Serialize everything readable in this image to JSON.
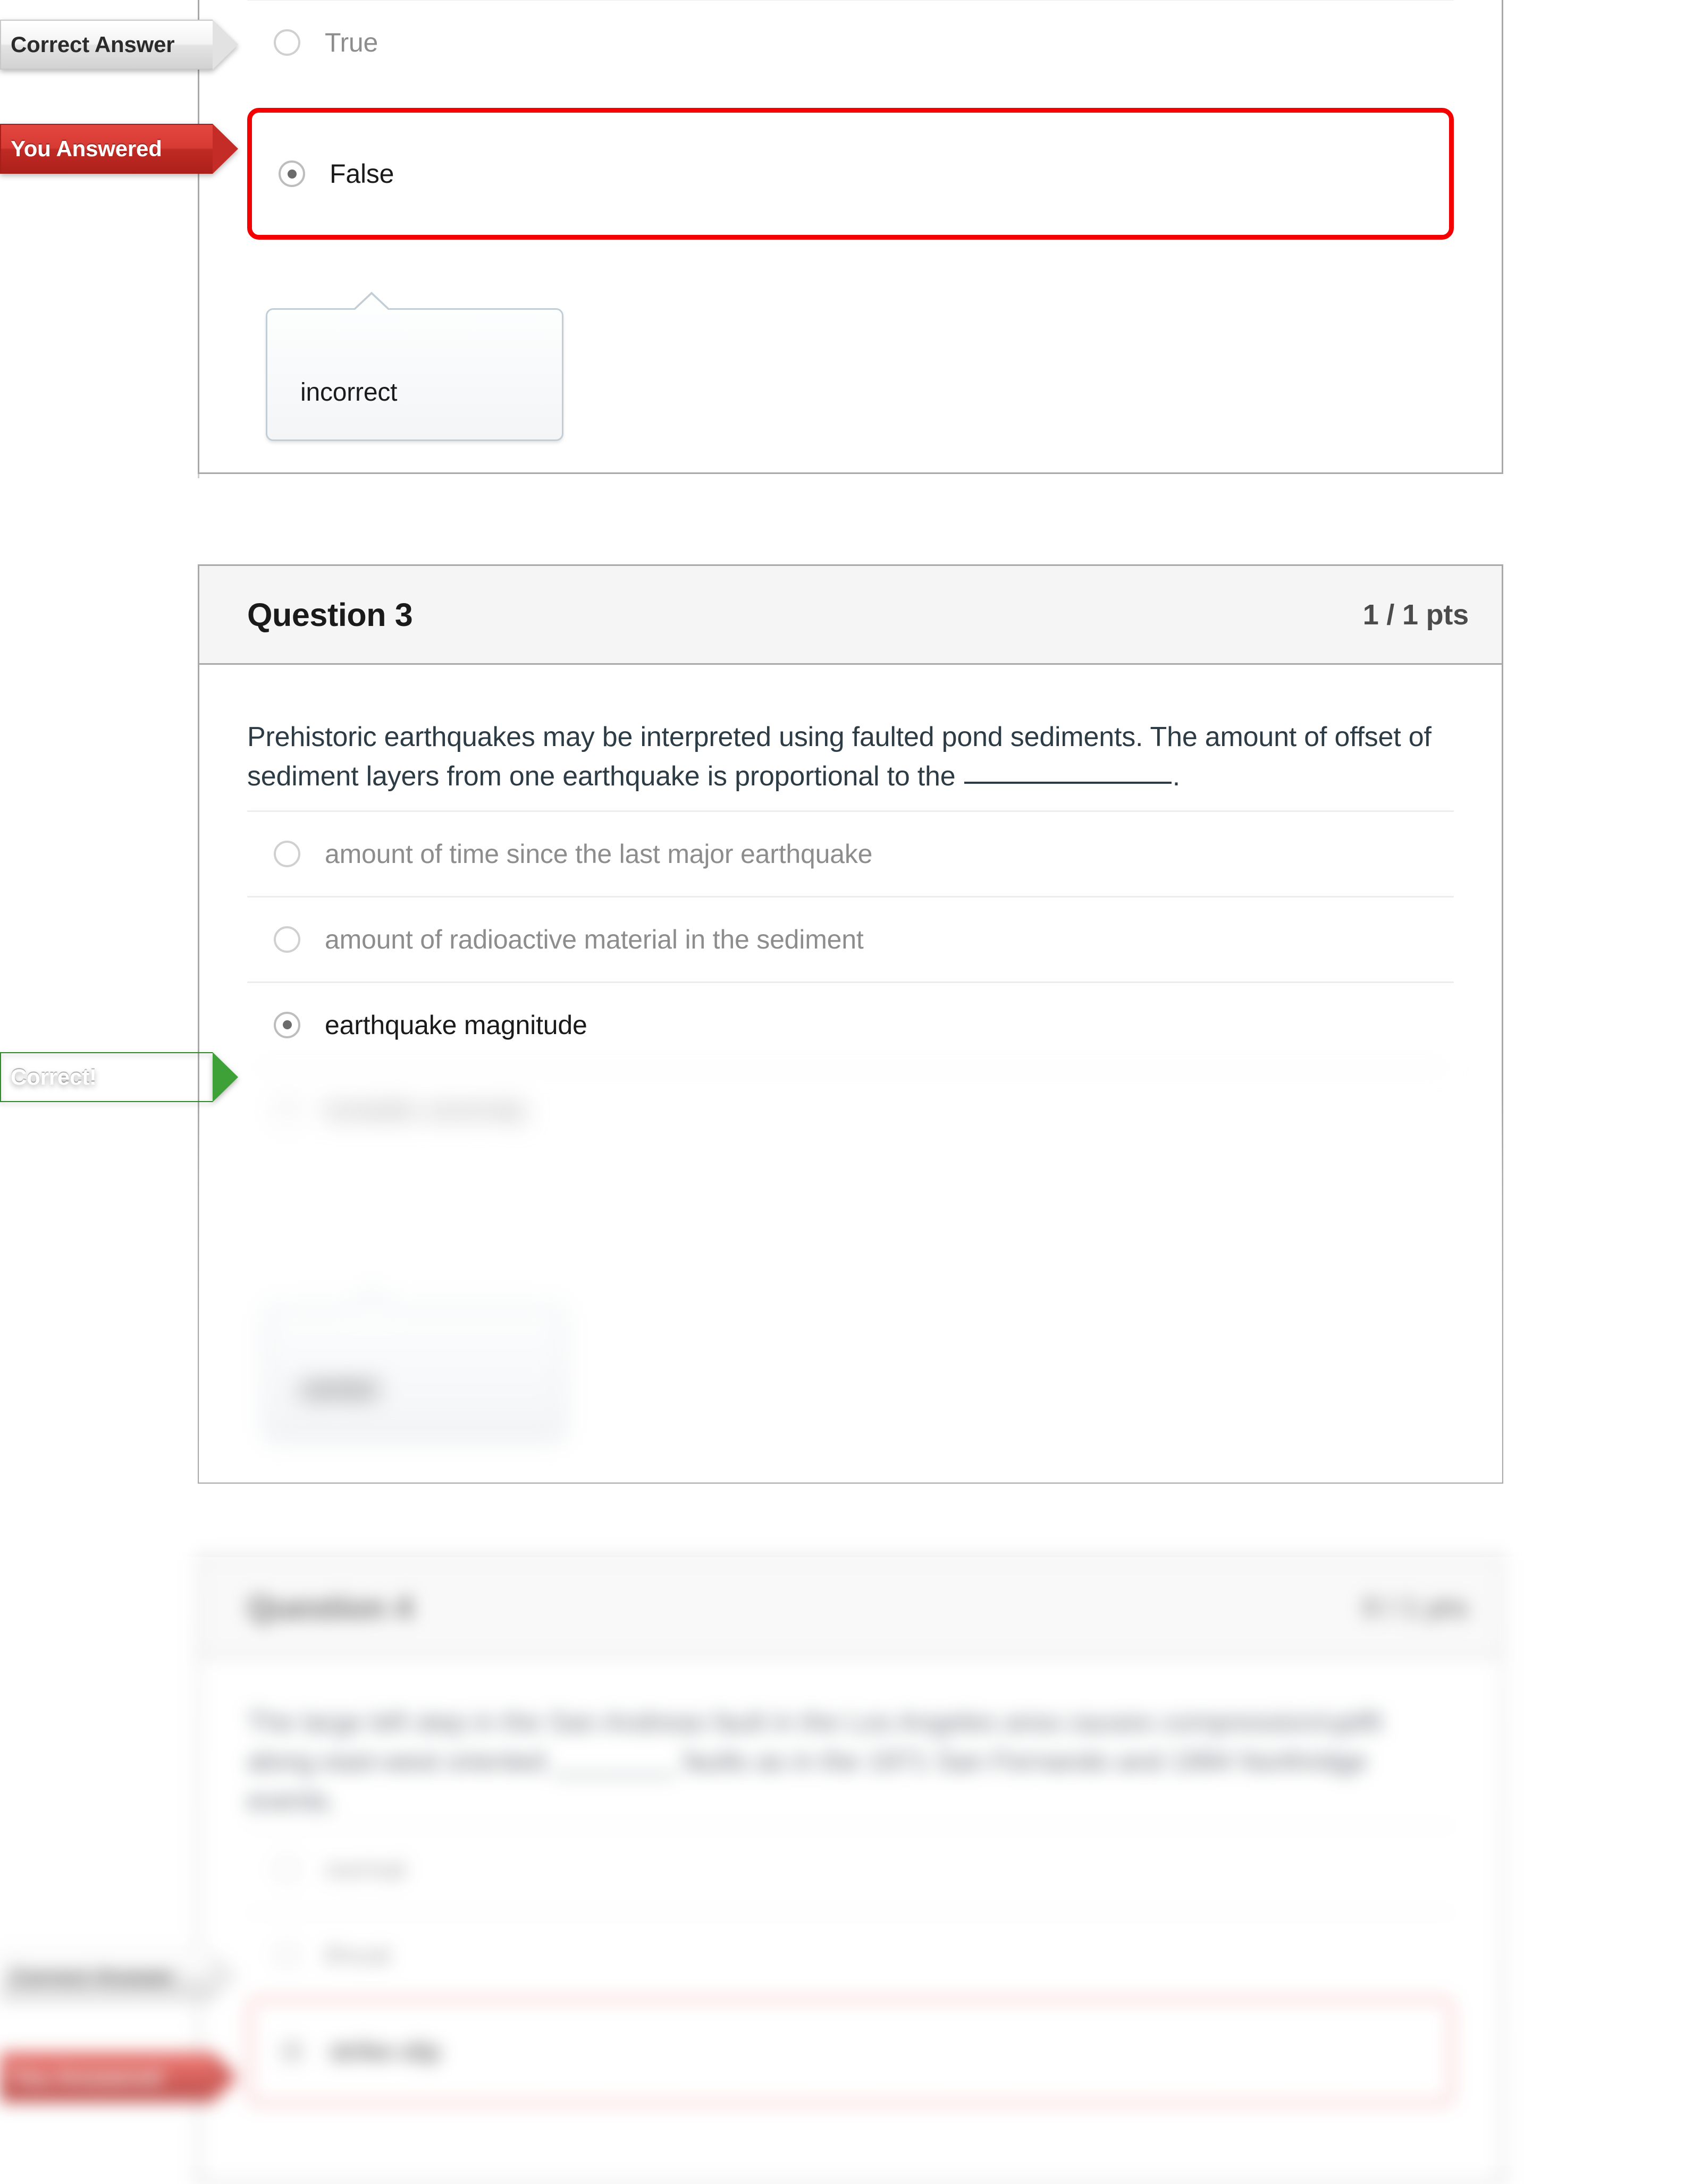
{
  "page": {
    "kind": "quiz-results",
    "accent_correct": "#3ea138",
    "accent_incorrect": "#c42d27",
    "accent_wrong_outline": "#f50000"
  },
  "flags": {
    "correct_answer": "Correct Answer",
    "you_answered": "You Answered",
    "correct": "Correct!"
  },
  "question2": {
    "options": [
      {
        "label": "True",
        "selected": false,
        "state": "correct-answer"
      },
      {
        "label": "False",
        "selected": true,
        "state": "you-answered-wrong"
      }
    ],
    "comment": "incorrect"
  },
  "question3": {
    "title": "Question 3",
    "points": "1 / 1 pts",
    "text_part1": "Prehistoric earthquakes may be interpreted using faulted pond sediments. The amount of offset of sediment layers from one earthquake is proportional to the ",
    "text_part2": ".",
    "options": [
      {
        "label": "amount of time since the last major earthquake",
        "selected": false,
        "state": "plain"
      },
      {
        "label": "amount of radioactive material in the sediment",
        "selected": false,
        "state": "plain"
      },
      {
        "label": "earthquake magnitude",
        "selected": true,
        "state": "correct"
      },
      {
        "label": "isostatic anomaly",
        "selected": false,
        "state": "plain"
      }
    ],
    "comment": "correct"
  },
  "question4": {
    "title": "Question 4",
    "points": "0 / 1 pts",
    "text": "The large left step in the San Andreas fault in the Los Angeles area causes compression/uplift along east-west oriented ________ faults as in the 1971 San Fernando and 1994 Northridge events.",
    "options": [
      {
        "label": "normal",
        "selected": false,
        "state": "plain"
      },
      {
        "label": "thrust",
        "selected": false,
        "state": "correct-answer"
      },
      {
        "label": "strike-slip",
        "selected": true,
        "state": "you-answered-wrong"
      }
    ]
  }
}
